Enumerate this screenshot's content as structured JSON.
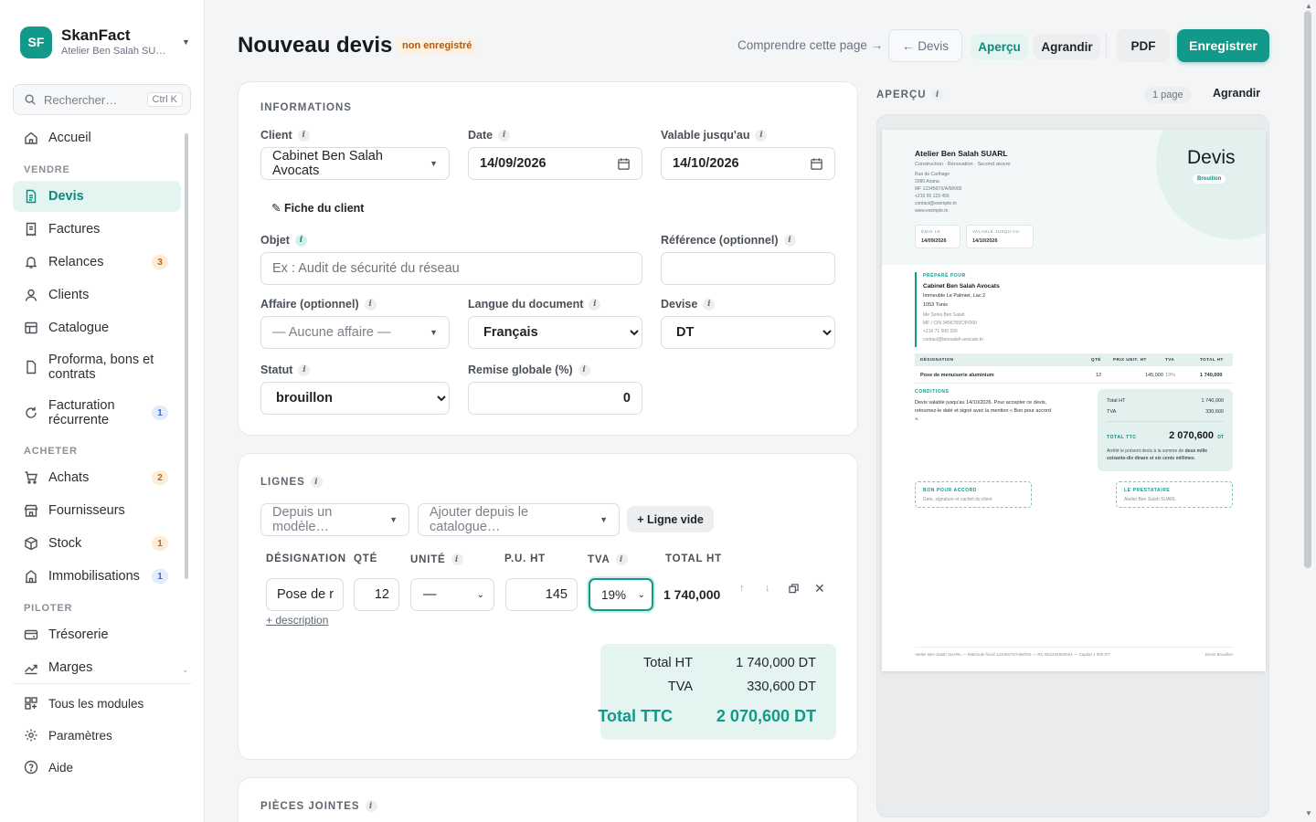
{
  "brand": {
    "logo": "SF",
    "name": "SkanFact",
    "subtitle": "Atelier Ben Salah SU…"
  },
  "search": {
    "placeholder": "Rechercher…",
    "shortcut": "Ctrl K"
  },
  "nav": {
    "home": "Accueil",
    "section_sell": "VENDRE",
    "quotes": "Devis",
    "invoices": "Factures",
    "reminders": "Relances",
    "reminders_badge": "3",
    "clients": "Clients",
    "catalog": "Catalogue",
    "proforma": "Proforma, bons et contrats",
    "recurring": "Facturation récurrente",
    "recurring_badge": "1",
    "section_buy": "ACHETER",
    "purchases": "Achats",
    "purchases_badge": "2",
    "suppliers": "Fournisseurs",
    "stock": "Stock",
    "stock_badge": "1",
    "assets": "Immobilisations",
    "assets_badge": "1",
    "section_drive": "PILOTER",
    "treasury": "Trésorerie",
    "margins": "Marges"
  },
  "footer_nav": {
    "modules": "Tous les modules",
    "settings": "Paramètres",
    "help": "Aide"
  },
  "header": {
    "title": "Nouveau devis",
    "status": "non enregistré",
    "help_link": "Comprendre cette page →",
    "back": "← Devis",
    "preview": "Aperçu",
    "enlarge": "Agrandir",
    "pdf": "PDF",
    "save": "Enregistrer"
  },
  "info": {
    "title": "INFORMATIONS",
    "client_label": "Client",
    "client_value": "Cabinet Ben Salah Avocats",
    "date_label": "Date",
    "date_value": "14/09/2026",
    "valid_label": "Valable jusqu'au",
    "valid_value": "14/10/2026",
    "client_sheet": "✎ Fiche du client",
    "subject_label": "Objet",
    "subject_placeholder": "Ex : Audit de sécurité du réseau",
    "reference_label": "Référence (optionnel)",
    "deal_label": "Affaire (optionnel)",
    "deal_value": "— Aucune affaire —",
    "language_label": "Langue du document",
    "language_value": "Français",
    "currency_label": "Devise",
    "currency_value": "DT",
    "status_label": "Statut",
    "status_value": "brouillon",
    "discount_label": "Remise globale (%)",
    "discount_value": "0"
  },
  "lines": {
    "title": "LIGNES",
    "from_template": "Depuis un modèle…",
    "from_catalog": "Ajouter depuis le catalogue…",
    "empty_line": "+ Ligne vide",
    "headers": {
      "designation": "DÉSIGNATION",
      "qty": "QTÉ",
      "unit": "UNITÉ",
      "unit_price": "P.U. HT",
      "vat": "TVA",
      "total": "TOTAL HT"
    },
    "rows": [
      {
        "designation": "Pose de r",
        "qty": "12",
        "unit": "—",
        "unit_price": "145",
        "vat": "19%",
        "total": "1 740,000"
      }
    ],
    "add_description": "+ description",
    "totals": {
      "ht_label": "Total HT",
      "ht_value": "1 740,000 DT",
      "vat_label": "TVA",
      "vat_value": "330,600 DT",
      "ttc_label": "Total TTC",
      "ttc_value": "2 070,600 DT"
    }
  },
  "attachments": {
    "title": "PIÈCES JOINTES"
  },
  "preview": {
    "title": "APERÇU",
    "pages": "1 page",
    "enlarge": "Agrandir",
    "doc": {
      "company": "Atelier Ben Salah SUARL",
      "tags": "Construction · Rénovation · Second œuvre",
      "address": [
        "Rue de Carthage",
        "2080 Ariana",
        "MF 1234567X/A/M/000",
        "+216 55 123 456",
        "contact@exemple.tn",
        "www.exemple.tn"
      ],
      "doc_type": "Devis",
      "doc_status": "Brouillon",
      "issued_label": "ÉMIS LE",
      "issued_value": "14/09/2026",
      "valid_label": "VALABLE JUSQU'AU",
      "valid_value": "14/10/2026",
      "prepared_for": "PRÉPARÉ POUR",
      "client_name": "Cabinet Ben Salah Avocats",
      "client_lines": [
        "Immeuble Le Palmier, Lac 2",
        "1053 Tunis"
      ],
      "client_muted": [
        "Me Sonia Ben Salah",
        "MF / CIN 3456789C/P/000",
        "+216 71 000 200",
        "contact@bensalah-avocats.tn"
      ],
      "table_headers": [
        "DÉSIGNATION",
        "QTÉ",
        "PRIX UNIT. HT",
        "TVA",
        "TOTAL HT"
      ],
      "row": [
        "Pose de menuiserie aluminium",
        "12",
        "145,000",
        "19%",
        "1 740,000"
      ],
      "conditions_label": "CONDITIONS",
      "conditions_text": [
        "Devis valable jusqu'au 14/10/2026. Pour accepter ce devis,",
        "retournez-le daté et signé avec la mention « Bon pour accord",
        "»."
      ],
      "total_ht_label": "Total HT",
      "total_ht_value": "1 740,000",
      "tva_label": "TVA",
      "tva_value": "330,600",
      "ttc_label": "TOTAL TTC",
      "ttc_value": "2 070,600",
      "ttc_unit": "DT",
      "words_1": "Arrêté le présent devis à la somme de ",
      "words_bold_1": "deux mille",
      "words_bold_2": "soixante-dix dinars et six cents millimes",
      "words_end": ".",
      "approval_label": "BON POUR ACCORD",
      "approval_sub": "Date, signature et cachet du client",
      "provider_label": "LE PRESTATAIRE",
      "provider_sub": "Atelier Ben Salah SUARL",
      "footer_left": "Atelier Ben Salah SUARL — Matricule fiscal 1234567X/A/M/000 — RC B01234562024 — Capital 1 000 DT",
      "footer_right": "Devis Brouillon"
    }
  },
  "colors": {
    "accent": "#12998a",
    "accent_soft": "#e3f4f1",
    "warning": "#c4620f",
    "info": "#2f6bd8"
  }
}
